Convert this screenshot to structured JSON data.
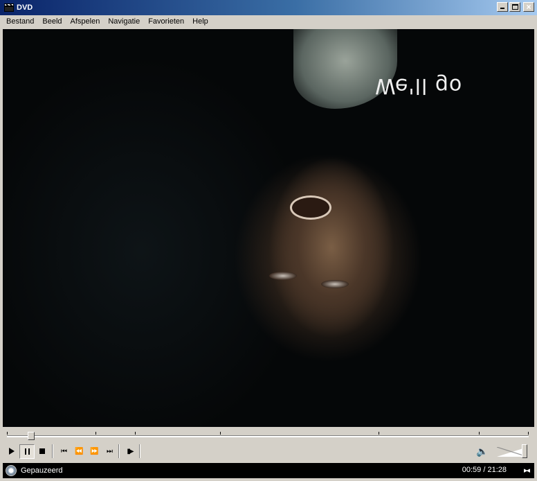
{
  "window": {
    "title": "DVD",
    "icon": "clapperboard-icon",
    "controls": {
      "minimize": "minimize-icon",
      "maximize": "maximize-icon",
      "close": "×"
    }
  },
  "menubar": {
    "items": [
      {
        "label": "Bestand"
      },
      {
        "label": "Beeld"
      },
      {
        "label": "Afspelen"
      },
      {
        "label": "Navigatie"
      },
      {
        "label": "Favorieten"
      },
      {
        "label": "Help"
      }
    ]
  },
  "video": {
    "subtitle": "We'll go"
  },
  "seek": {
    "position_fraction": 0.046
  },
  "controls": {
    "play": "play-icon",
    "pause": "pause-icon",
    "stop": "stop-icon",
    "previous": "⏮",
    "rewind": "⏪",
    "fast_forward": "⏩",
    "next": "⏭",
    "step": "▮▶",
    "volume_icon": "🔈",
    "volume_fraction": 0.9
  },
  "status": {
    "text": "Gepauzeerd",
    "time": "00:59 / 21:28",
    "compact_icon": "▸◂"
  },
  "colors": {
    "titlebar_start": "#0a246a",
    "titlebar_end": "#a6caf0",
    "chrome": "#d4d0c8",
    "statusbar_bg": "#000000"
  }
}
